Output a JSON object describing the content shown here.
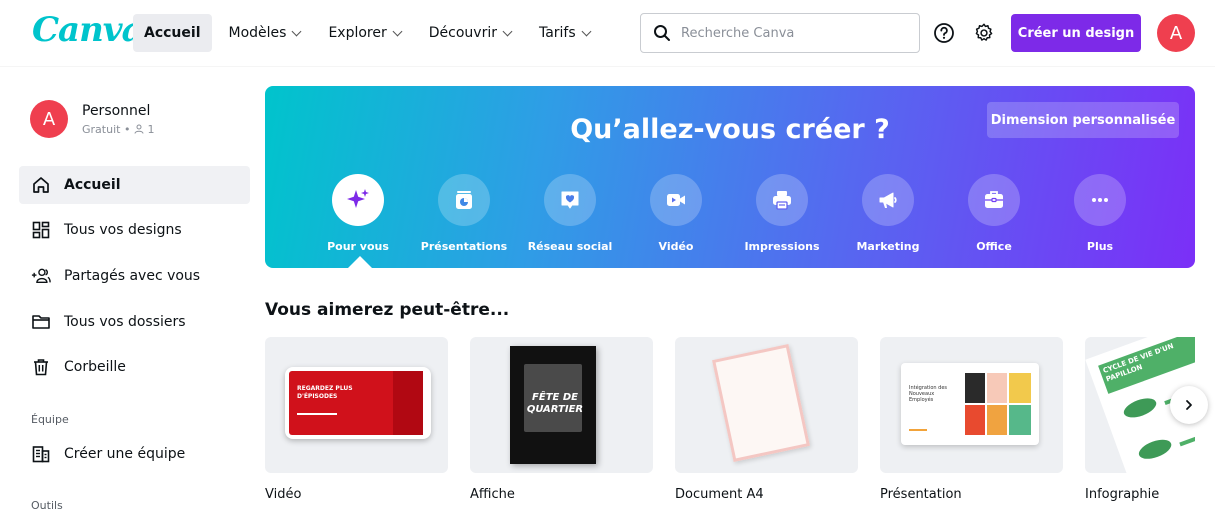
{
  "brand": {
    "logo": "Canva",
    "logo_color": "#00c4cc",
    "accent": "#7d2ae8",
    "avatar_color": "#ef3f4f"
  },
  "nav": {
    "items": [
      {
        "label": "Accueil",
        "active": true,
        "dropdown": false
      },
      {
        "label": "Modèles",
        "dropdown": true
      },
      {
        "label": "Explorer",
        "dropdown": true
      },
      {
        "label": "Découvrir",
        "dropdown": true
      },
      {
        "label": "Tarifs",
        "dropdown": true
      }
    ]
  },
  "search": {
    "placeholder": "Recherche Canva",
    "icon": "search-icon"
  },
  "toolbar": {
    "help_icon": "help-icon",
    "settings_icon": "gear-icon",
    "create_label": "Créer un design",
    "avatar_initial": "A"
  },
  "profile": {
    "initial": "A",
    "name": "Personnel",
    "plan": "Gratuit",
    "members": "1"
  },
  "sidebar": {
    "items": [
      {
        "label": "Accueil",
        "icon": "home-icon",
        "active": true
      },
      {
        "label": "Tous vos designs",
        "icon": "grid-icon"
      },
      {
        "label": "Partagés avec vous",
        "icon": "shared-users-icon"
      },
      {
        "label": "Tous vos dossiers",
        "icon": "folder-icon"
      },
      {
        "label": "Corbeille",
        "icon": "trash-icon"
      }
    ],
    "team_section": "Équipe",
    "team_item": {
      "label": "Créer une équipe",
      "icon": "team-building-icon"
    },
    "tools_section": "Outils"
  },
  "hero": {
    "title": "Qu’allez-vous créer ?",
    "custom_size_label": "Dimension personnalisée",
    "categories": [
      {
        "label": "Pour vous",
        "icon": "sparkle-icon",
        "active": true
      },
      {
        "label": "Présentations",
        "icon": "presentation-icon"
      },
      {
        "label": "Réseau social",
        "icon": "social-heart-icon"
      },
      {
        "label": "Vidéo",
        "icon": "video-camera-icon"
      },
      {
        "label": "Impressions",
        "icon": "printer-icon"
      },
      {
        "label": "Marketing",
        "icon": "megaphone-icon"
      },
      {
        "label": "Office",
        "icon": "briefcase-icon"
      },
      {
        "label": "Plus",
        "icon": "more-dots-icon"
      }
    ]
  },
  "suggestions": {
    "title": "Vous aimerez peut-être...",
    "cards": [
      {
        "label": "Vidéo",
        "thumb_text": "REGARDEZ PLUS D'ÉPISODES"
      },
      {
        "label": "Affiche",
        "thumb_text": "FÊTE DE QUARTIER"
      },
      {
        "label": "Document A4"
      },
      {
        "label": "Présentation",
        "thumb_text": "Intégration des Nouveaux Employés"
      },
      {
        "label": "Infographie",
        "thumb_text": "CYCLE DE VIE D'UN PAPILLON"
      }
    ]
  }
}
